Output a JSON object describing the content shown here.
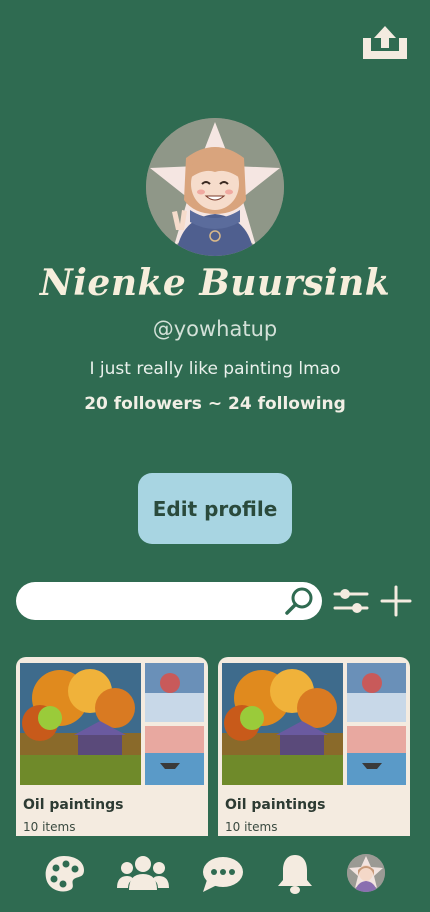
{
  "profile": {
    "display_name": "Nienke Buursink",
    "handle": "@yowhatup",
    "bio": "I just really like painting lmao",
    "stats": "20 followers ~ 24 following"
  },
  "actions": {
    "edit_profile_label": "Edit profile"
  },
  "search": {
    "value": "",
    "placeholder": ""
  },
  "collections": [
    {
      "name": "Oil paintings",
      "count": "10 items"
    },
    {
      "name": "Oil paintings",
      "count": "10 items"
    }
  ],
  "colors": {
    "background": "#2f6b51",
    "card": "#f4ebe0",
    "accent_button": "#a8d5e2"
  },
  "icons": {
    "share": "share-upload-icon",
    "search": "search-icon",
    "filter": "sliders-icon",
    "add": "plus-icon",
    "nav": [
      "palette-icon",
      "people-icon",
      "chat-icon",
      "bell-icon",
      "avatar"
    ]
  }
}
